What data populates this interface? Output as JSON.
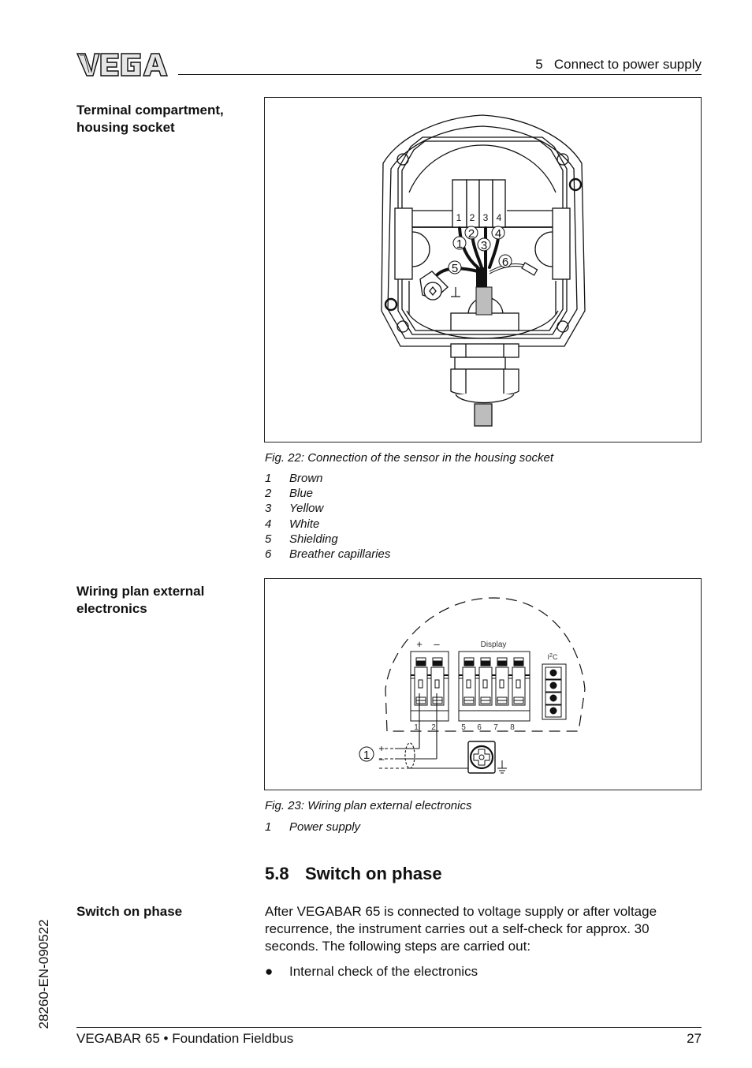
{
  "header": {
    "logo_text": "VEGA",
    "chapter": "5   Connect to power supply"
  },
  "section1": {
    "side_heading_line1": "Terminal compartment,",
    "side_heading_line2": "housing socket",
    "figure": {
      "terminal_numbers": [
        "1",
        "2",
        "3",
        "4"
      ],
      "callouts": [
        "1",
        "2",
        "3",
        "4",
        "5",
        "6"
      ],
      "cable_jacket_color": "#bdbdbd"
    },
    "caption": "Fig. 22: Connection of the sensor in the housing socket",
    "legend": [
      {
        "num": "1",
        "label": "Brown"
      },
      {
        "num": "2",
        "label": "Blue"
      },
      {
        "num": "3",
        "label": "Yellow"
      },
      {
        "num": "4",
        "label": "White"
      },
      {
        "num": "5",
        "label": "Shielding"
      },
      {
        "num": "6",
        "label": "Breather capillaries"
      }
    ]
  },
  "section2": {
    "side_heading_line1": "Wiring plan external",
    "side_heading_line2": "electronics",
    "figure": {
      "plus_label": "+",
      "minus_label": "–",
      "display_label": "Display",
      "i2c_label_base": "I",
      "i2c_label_sup": "2",
      "i2c_label_end": "C",
      "terminal_numbers": [
        "1",
        "2",
        "5",
        "6",
        "7",
        "8"
      ],
      "callout": "1",
      "supply_plus": "+",
      "supply_minus": "–"
    },
    "caption": "Fig. 23: Wiring plan external electronics",
    "legend": [
      {
        "num": "1",
        "label": "Power supply"
      }
    ]
  },
  "section3": {
    "heading_num": "5.8",
    "heading_title": "Switch on phase",
    "side_heading": "Switch on phase",
    "paragraph": "After VEGABAR 65 is connected to voltage supply or after voltage recurrence, the instrument carries out a self-check for approx. 30 seconds. The following steps are carried out:",
    "bullets": [
      "Internal check of the electronics"
    ]
  },
  "footer": {
    "left": "VEGABAR 65 • Foundation Fieldbus",
    "page": "27",
    "doc_id": "28260-EN-090522"
  }
}
